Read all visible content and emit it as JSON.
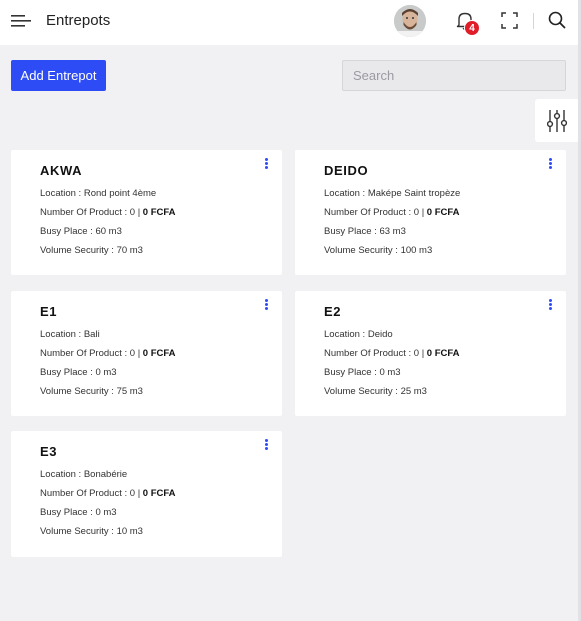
{
  "header": {
    "title": "Entrepots",
    "notification_count": "4",
    "icons": [
      "menu-icon",
      "bell-icon",
      "expand-icon",
      "search-icon"
    ]
  },
  "toolbar": {
    "add_label": "Add Entrepot",
    "search_placeholder": "Search"
  },
  "labels": {
    "location": "Location : ",
    "products": "Number Of Product : ",
    "busy": "Busy Place : ",
    "security": "Volume Security : "
  },
  "colors": {
    "accent": "#2e4cf5",
    "badge": "#e11d2a",
    "background": "#f1f1f4"
  },
  "warehouses": [
    {
      "name": "AKWA",
      "location": "Rond point 4ème",
      "products": "0 | ",
      "value": "0 FCFA",
      "busy": "60 m3",
      "security": "70 m3"
    },
    {
      "name": "DEIDO",
      "location": "Maképe Saint tropèze",
      "products": "0 | ",
      "value": "0 FCFA",
      "busy": "63 m3",
      "security": "100 m3"
    },
    {
      "name": "E1",
      "location": "Bali",
      "products": "0 | ",
      "value": "0 FCFA",
      "busy": "0 m3",
      "security": "75 m3"
    },
    {
      "name": "E2",
      "location": "Deido",
      "products": "0 | ",
      "value": "0 FCFA",
      "busy": "0 m3",
      "security": "25 m3"
    },
    {
      "name": "E3",
      "location": "Bonabérie",
      "products": "0 | ",
      "value": "0 FCFA",
      "busy": "0 m3",
      "security": "10 m3"
    }
  ]
}
